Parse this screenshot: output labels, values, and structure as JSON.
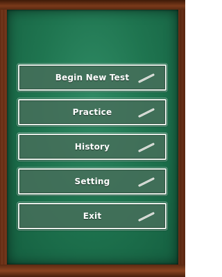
{
  "menu": {
    "items": [
      {
        "id": "begin-new-test",
        "label": "Begin New Test"
      },
      {
        "id": "practice",
        "label": "Practice"
      },
      {
        "id": "history",
        "label": "History"
      },
      {
        "id": "setting",
        "label": "Setting"
      },
      {
        "id": "exit",
        "label": "Exit"
      }
    ]
  },
  "icons": {
    "button_decoration": "chalk-icon"
  },
  "colors": {
    "board": "#1f7550",
    "frame": "#7a3a1a",
    "button_fill": "#466e5a",
    "button_border": "#e8efe9",
    "text": "#ffffff"
  }
}
